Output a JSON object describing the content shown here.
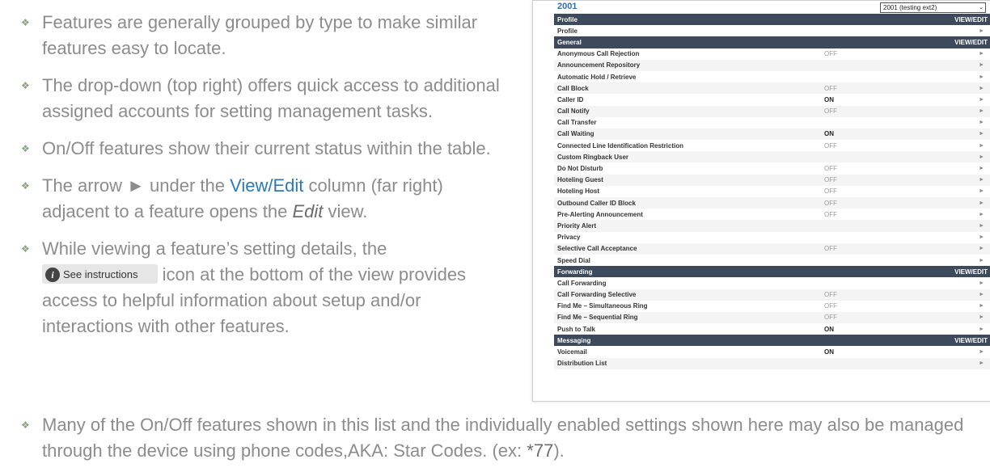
{
  "bullets": [
    {
      "text": "Features are generally grouped by type to make similar features easy to locate."
    },
    {
      "text": "The drop-down (top right) offers quick access to additional assigned accounts for setting management tasks."
    },
    {
      "text": "On/Off features show their current status within the table."
    },
    {
      "pre": "The arrow ► under the ",
      "link": "View/Edit",
      "mid": " column (far right) adjacent to a feature opens the ",
      "italic": "Edit",
      "post": " view."
    },
    {
      "pre": "While viewing a feature’s setting details, the ",
      "button_label": "See instructions",
      "post": " icon at the bottom of the view provides access to helpful information about setup and/or interactions with other features."
    }
  ],
  "bottom_bullet": {
    "pre": "Many of the On/Off features shown in this list  and the individually enabled settings shown here may also be managed through the device using phone codes,AKA: Star Codes. (ex: ",
    "code": "*77",
    "post": ")."
  },
  "panel": {
    "account": "2001",
    "selected_account": "2001 (testing ext2)",
    "view_edit_label": "VIEW/EDIT",
    "arrow": "►",
    "sections": [
      {
        "title": "Profile",
        "rows": [
          {
            "name": "Profile",
            "status": ""
          }
        ]
      },
      {
        "title": "General",
        "rows": [
          {
            "name": "Anonymous Call Rejection",
            "status": "OFF"
          },
          {
            "name": "Announcement Repository",
            "status": ""
          },
          {
            "name": "Automatic Hold / Retrieve",
            "status": ""
          },
          {
            "name": "Call Block",
            "status": "OFF"
          },
          {
            "name": "Caller ID",
            "status": "ON"
          },
          {
            "name": "Call Notify",
            "status": "OFF"
          },
          {
            "name": "Call Transfer",
            "status": ""
          },
          {
            "name": "Call Waiting",
            "status": "ON"
          },
          {
            "name": "Connected Line Identification Restriction",
            "status": "OFF"
          },
          {
            "name": "Custom Ringback User",
            "status": ""
          },
          {
            "name": "Do Not Disturb",
            "status": "OFF"
          },
          {
            "name": "Hoteling Guest",
            "status": "OFF"
          },
          {
            "name": "Hoteling Host",
            "status": "OFF"
          },
          {
            "name": "Outbound Caller ID Block",
            "status": "OFF"
          },
          {
            "name": "Pre-Alerting Announcement",
            "status": "OFF"
          },
          {
            "name": "Priority Alert",
            "status": ""
          },
          {
            "name": "Privacy",
            "status": ""
          },
          {
            "name": "Selective Call Acceptance",
            "status": "OFF"
          },
          {
            "name": "Speed Dial",
            "status": ""
          }
        ]
      },
      {
        "title": "Forwarding",
        "rows": [
          {
            "name": "Call Forwarding",
            "status": ""
          },
          {
            "name": "Call Forwarding Selective",
            "status": "OFF"
          },
          {
            "name": "Find Me – Simultaneous Ring",
            "status": "OFF"
          },
          {
            "name": "Find Me – Sequential Ring",
            "status": "OFF"
          },
          {
            "name": "Push to Talk",
            "status": "ON"
          }
        ]
      },
      {
        "title": "Messaging",
        "rows": [
          {
            "name": "Voicemail",
            "status": "ON"
          },
          {
            "name": "Distribution List",
            "status": ""
          }
        ]
      }
    ]
  }
}
